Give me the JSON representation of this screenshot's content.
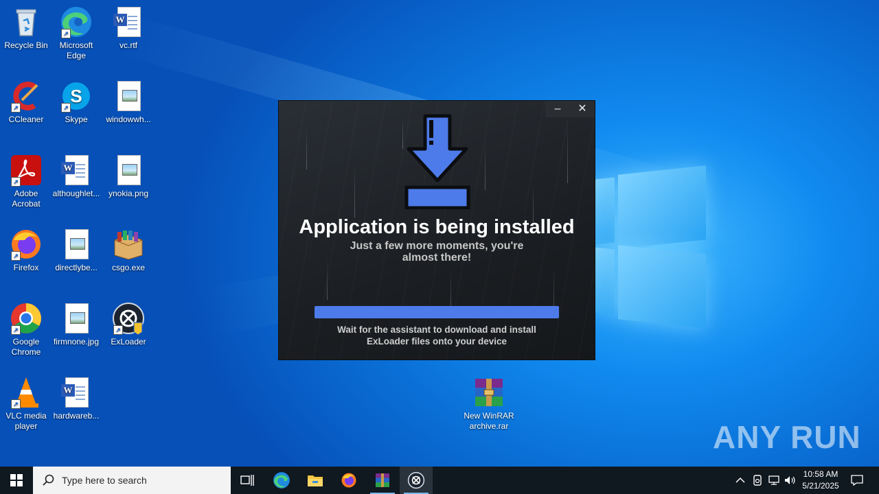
{
  "desktop": {
    "icons": [
      {
        "label": "Recycle Bin"
      },
      {
        "label": "Microsoft Edge"
      },
      {
        "label": "vc.rtf"
      },
      {
        "label": "CCleaner"
      },
      {
        "label": "Skype"
      },
      {
        "label": "windowwh..."
      },
      {
        "label": "Adobe Acrobat"
      },
      {
        "label": "althoughlet..."
      },
      {
        "label": "ynokia.png"
      },
      {
        "label": "Firefox"
      },
      {
        "label": "directlybe..."
      },
      {
        "label": "csgo.exe"
      },
      {
        "label": "Google Chrome"
      },
      {
        "label": "firmnone.jpg"
      },
      {
        "label": "ExLoader"
      },
      {
        "label": "VLC media player"
      },
      {
        "label": "hardwareb..."
      },
      {
        "label": "New WinRAR archive.rar"
      }
    ],
    "watermark": "ANY RUN"
  },
  "installer": {
    "minimize_label": "–",
    "close_label": "✕",
    "title": "Application is being installed",
    "subtitle_line1": "Just a few more moments, you're",
    "subtitle_line2": "almost there!",
    "progress_percent": 100,
    "progress_color": "#4e7bea",
    "footer_line1": "Wait for the assistant to download and install",
    "footer_line2": "ExLoader files onto your device"
  },
  "taskbar": {
    "search_placeholder": "Type here to search",
    "time": "10:58 AM",
    "date": "5/21/2025"
  }
}
